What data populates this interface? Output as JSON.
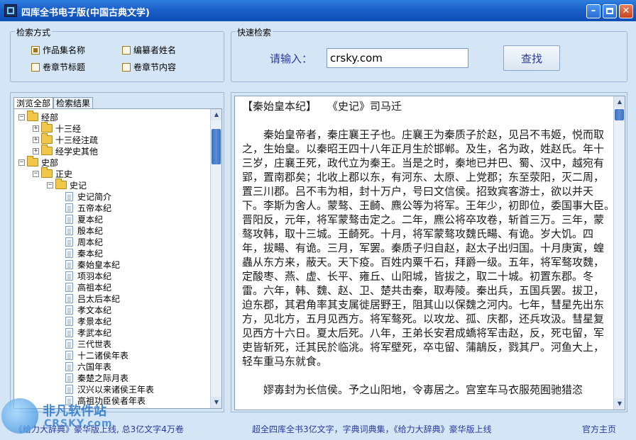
{
  "window": {
    "title": "四库全书电子版(中国古典文学)"
  },
  "search_mode": {
    "legend": "检索方式",
    "options": [
      {
        "label": "作品集名称",
        "checked": true
      },
      {
        "label": "编纂者姓名",
        "checked": false
      },
      {
        "label": "卷章节标题",
        "checked": false
      },
      {
        "label": "卷章节内容",
        "checked": false
      }
    ]
  },
  "quick_search": {
    "legend": "快速检索",
    "prompt": "请输入：",
    "value": "crsky.com",
    "button": "查找"
  },
  "tabs": [
    {
      "label": "浏览全部",
      "active": true
    },
    {
      "label": "检索结果",
      "active": false
    }
  ],
  "tree": [
    {
      "label": "经部",
      "level": 0,
      "kind": "folder",
      "expander": "−"
    },
    {
      "label": "十三经",
      "level": 1,
      "kind": "folder",
      "expander": "+"
    },
    {
      "label": "十三经注疏",
      "level": 1,
      "kind": "folder",
      "expander": "+"
    },
    {
      "label": "经学史其他",
      "level": 1,
      "kind": "folder",
      "expander": "+"
    },
    {
      "label": "史部",
      "level": 0,
      "kind": "folder",
      "expander": "−"
    },
    {
      "label": "正史",
      "level": 1,
      "kind": "folder",
      "expander": "−"
    },
    {
      "label": "史记",
      "level": 2,
      "kind": "folder",
      "expander": "−"
    },
    {
      "label": "史记简介",
      "level": 3,
      "kind": "doc"
    },
    {
      "label": "五帝本纪",
      "level": 3,
      "kind": "doc"
    },
    {
      "label": "夏本纪",
      "level": 3,
      "kind": "doc"
    },
    {
      "label": "殷本纪",
      "level": 3,
      "kind": "doc"
    },
    {
      "label": "周本纪",
      "level": 3,
      "kind": "doc"
    },
    {
      "label": "秦本纪",
      "level": 3,
      "kind": "doc"
    },
    {
      "label": "秦始皇本纪",
      "level": 3,
      "kind": "doc"
    },
    {
      "label": "项羽本纪",
      "level": 3,
      "kind": "doc"
    },
    {
      "label": "高祖本纪",
      "level": 3,
      "kind": "doc"
    },
    {
      "label": "吕太后本纪",
      "level": 3,
      "kind": "doc"
    },
    {
      "label": "孝文本纪",
      "level": 3,
      "kind": "doc"
    },
    {
      "label": "孝景本纪",
      "level": 3,
      "kind": "doc"
    },
    {
      "label": "孝武本纪",
      "level": 3,
      "kind": "doc"
    },
    {
      "label": "三代世表",
      "level": 3,
      "kind": "doc"
    },
    {
      "label": "十二诸侯年表",
      "level": 3,
      "kind": "doc"
    },
    {
      "label": "六国年表",
      "level": 3,
      "kind": "doc"
    },
    {
      "label": "秦楚之际月表",
      "level": 3,
      "kind": "doc"
    },
    {
      "label": "汉兴以来诸侯王年表",
      "level": 3,
      "kind": "doc"
    },
    {
      "label": "高祖功臣侯者年表",
      "level": 3,
      "kind": "doc"
    }
  ],
  "reader": {
    "heading": "【秦始皇本纪】　　《史记》司马迁",
    "paragraphs": [
      "秦始皇帝者，秦庄襄王子也。庄襄王为秦质子於赵，见吕不韦姬，悦而取之，生始皇。以秦昭王四十八年正月生於邯郸。及生，名为政，姓赵氏。年十三岁，庄襄王死，政代立为秦王。当是之时，秦地已并巴、蜀、汉中，越宛有郢，置南郡矣；北收上郡以东，有河东、太原、上党郡；东至荥阳，灭二周，置三川郡。吕不韦为相，封十万户，号曰文信侯。招致宾客游士，欲以并天下。李斯为舍人。蒙骜、王齮、麃公等为将军。王年少，初即位，委国事大臣。　　晋阳反，元年，将军蒙骜击定之。二年，麃公将卒攻卷，斩首三万。三年，蒙骜攻韩，取十三城。王齮死。十月，将军蒙骜攻魏氏畼、有诡。岁大饥。四年，拔畼、有诡。三月，军罢。秦质子归自赵，赵太子出归国。十月庚寅，蝗蟲从东方来，蔽天。天下疫。百姓内粟千石，拜爵一级。五年，将军骜攻魏，定酸枣、燕、虚、长平、雍丘、山阳城，皆拔之，取二十城。初置东郡。冬雷。六年，韩、魏、赵、卫、楚共击秦，取寿陵。秦出兵，五国兵罢。拔卫，迫东郡，其君角率其支属徙居野王，阻其山以保魏之河内。七年，彗星先出东方，见北方，五月见西方。将军骜死。以攻龙、孤、庆都，还兵攻汲。彗星复见西方十六日。夏太后死。八年，王弟长安君成蟜将军击赵，反，死屯留，军吏皆斩死，迁其民於临洮。将军壁死，卒屯留、蒲鶮反，戮其尸。河鱼大上，轻车重马东就食。",
      "嫪毐封为长信侯。予之山阳地，令毐居之。宫室车马衣服苑囿驰猎恣"
    ]
  },
  "status": {
    "left": "《给力大辞典》豪华版上线, 总3亿文字4万卷",
    "middle": "超全四库全书3亿文字，字典词典集，《给力大辞典》豪华版上线",
    "right": "官方主页"
  },
  "watermark": {
    "text": "非凡软件站",
    "sub": "CRSKY.com"
  }
}
